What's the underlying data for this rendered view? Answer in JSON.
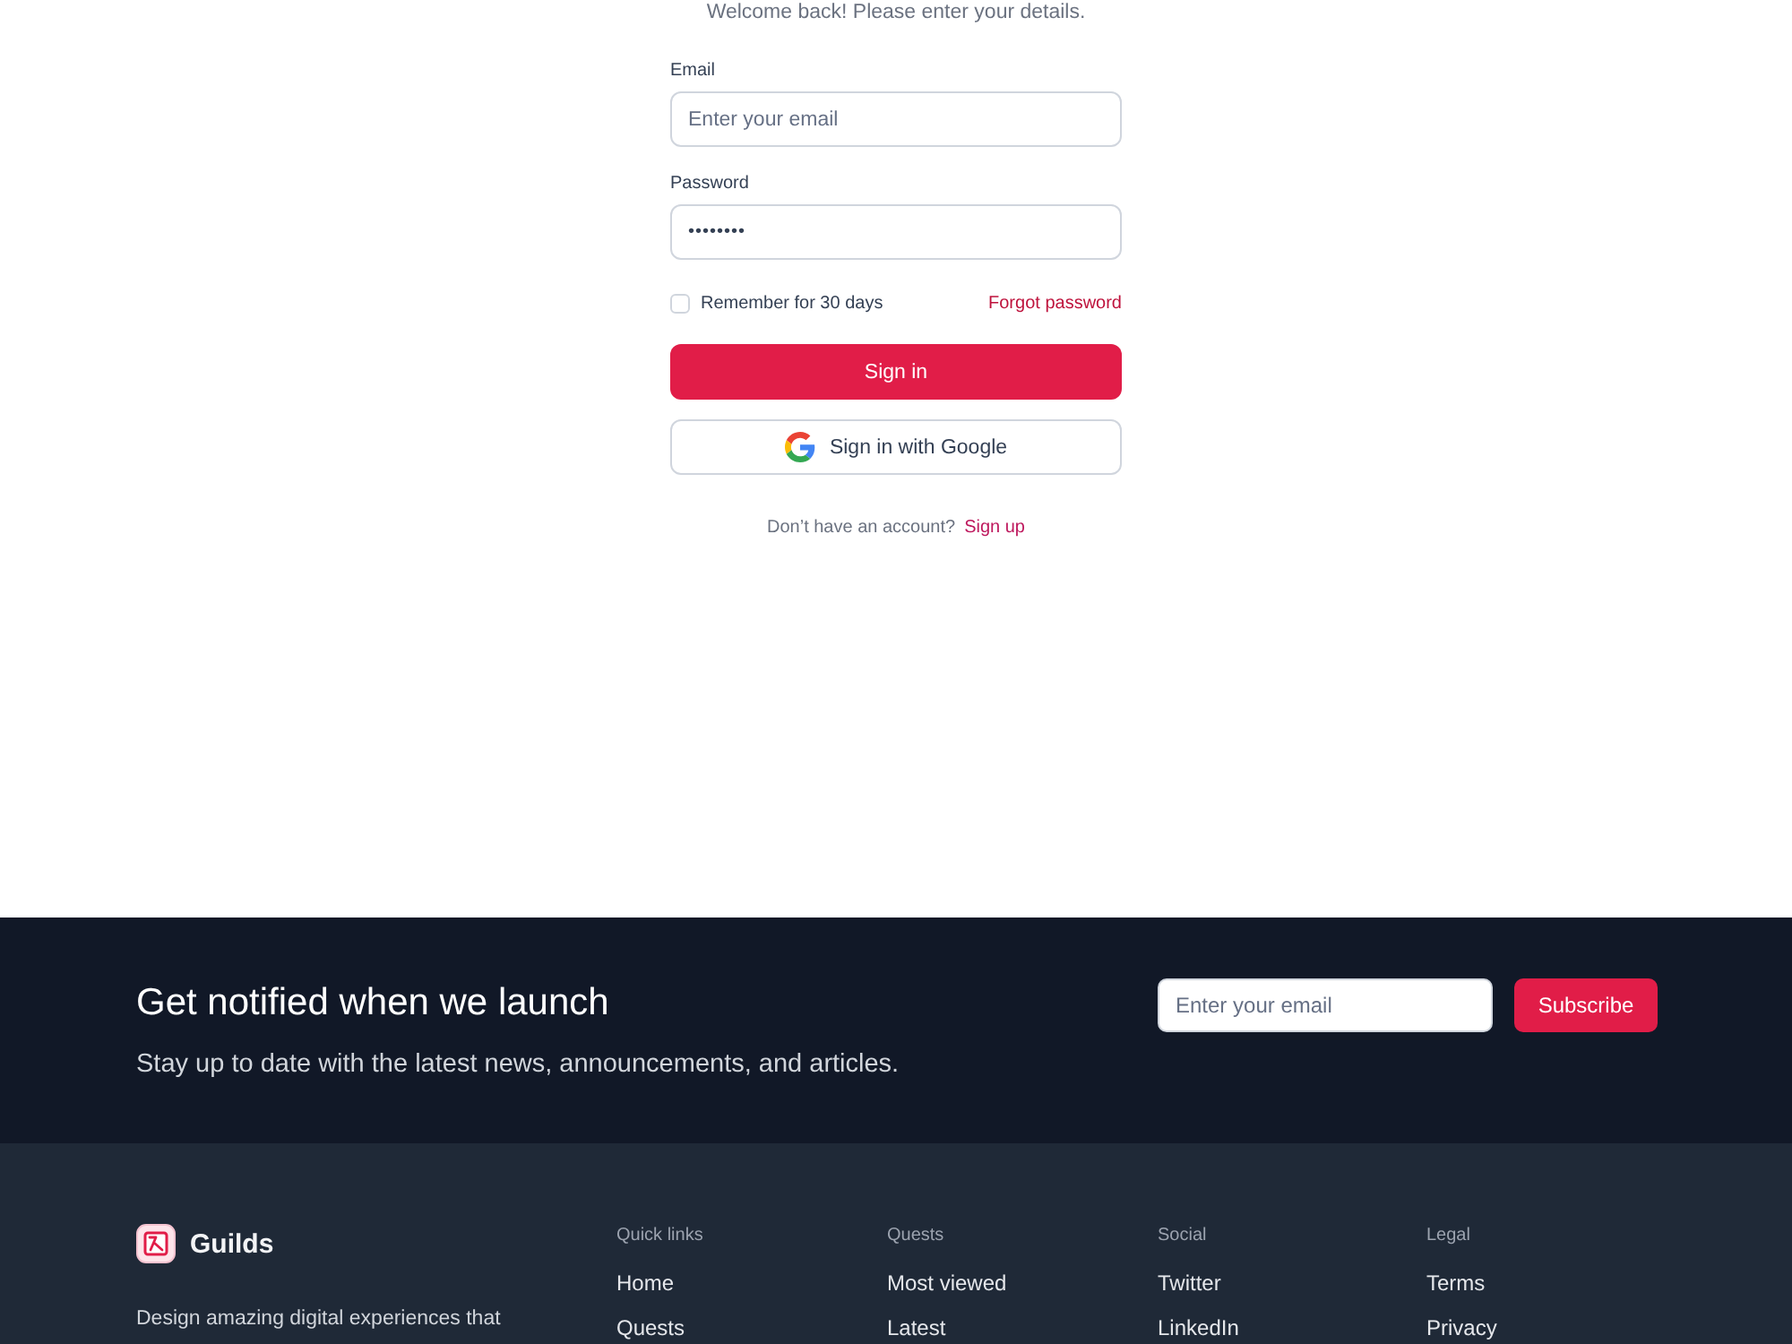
{
  "login": {
    "subtitle": "Welcome back! Please enter your details.",
    "fields": [
      {
        "kind": "email",
        "label": "Email",
        "placeholder": "Enter your email"
      },
      {
        "kind": "password",
        "label": "Password",
        "value": "••••••••"
      }
    ],
    "remember": {
      "label": "Remember for 30 days",
      "checked": false
    },
    "forgot_link": "Forgot password",
    "sign_in_button": "Sign in",
    "google_button": "Sign in with Google",
    "signup_prompt": "Don’t have an account?",
    "signup_link": "Sign up"
  },
  "newsletter": {
    "title": "Get notified when we launch",
    "text": "Stay up to date with the latest news, announcements, and articles.",
    "email_placeholder": "Enter your email",
    "button": "Subscribe"
  },
  "footer": {
    "brand": "Guilds",
    "description": "Design amazing digital experiences that",
    "columns": [
      {
        "heading": "Quick links",
        "links": [
          "Home",
          "Quests"
        ]
      },
      {
        "heading": "Quests",
        "links": [
          "Most viewed",
          "Latest"
        ]
      },
      {
        "heading": "Social",
        "links": [
          "Twitter",
          "LinkedIn"
        ]
      },
      {
        "heading": "Legal",
        "links": [
          "Terms",
          "Privacy"
        ]
      }
    ]
  }
}
